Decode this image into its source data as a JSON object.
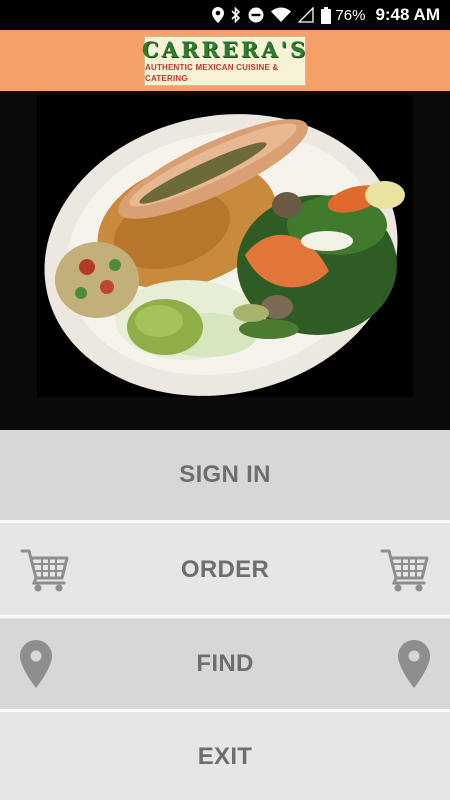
{
  "status_bar": {
    "battery": "76%",
    "time": "9:48 AM",
    "icons": [
      "location-icon",
      "bluetooth-icon",
      "do-not-disturb-icon",
      "wifi-icon",
      "cellular-signal-icon",
      "battery-icon"
    ]
  },
  "header": {
    "logo_title": "CARRERA'S",
    "logo_subtitle": "AUTHENTIC MEXICAN CUISINE & CATERING",
    "background": "#f4a068"
  },
  "menu": {
    "sign_in": "SIGN IN",
    "order": "ORDER",
    "find": "FIND",
    "exit": "EXIT",
    "order_icon": "shopping-cart-icon",
    "find_icon": "map-pin-icon"
  }
}
